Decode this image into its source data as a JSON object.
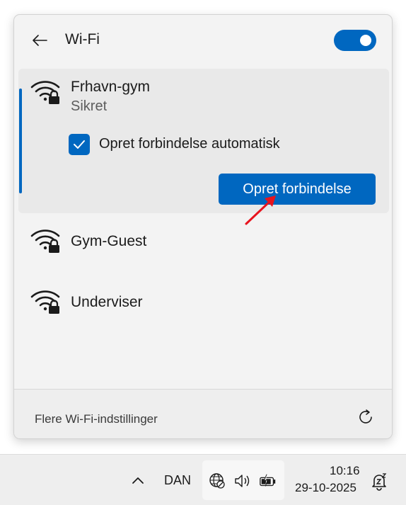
{
  "flyout": {
    "title": "Wi-Fi",
    "wifi_enabled": true,
    "networks": [
      {
        "ssid": "Frhavn-gym",
        "status": "Sikret",
        "auto_connect_label": "Opret forbindelse automatisk",
        "auto_connect_checked": true,
        "connect_label": "Opret forbindelse",
        "selected": true
      },
      {
        "ssid": "Gym-Guest"
      },
      {
        "ssid": "Underviser"
      }
    ],
    "footer_link": "Flere Wi-Fi-indstillinger"
  },
  "taskbar": {
    "language": "DAN",
    "time": "10:16",
    "date": "29-10-2025"
  },
  "colors": {
    "accent": "#0067c0",
    "panel": "#f3f3f3",
    "annotation_arrow": "#e8141e"
  }
}
